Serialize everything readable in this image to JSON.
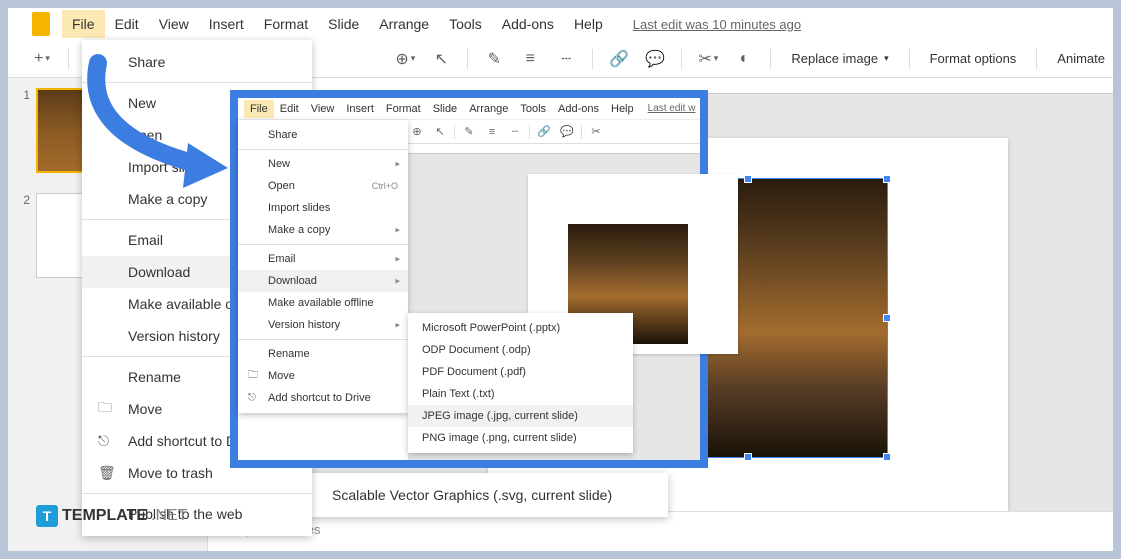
{
  "bg": {
    "menubar": {
      "items": [
        "File",
        "Edit",
        "View",
        "Insert",
        "Format",
        "Slide",
        "Arrange",
        "Tools",
        "Add-ons",
        "Help"
      ],
      "last_edit": "Last edit was 10 minutes ago"
    },
    "toolbar": {
      "replace_image": "Replace image",
      "format_options": "Format options",
      "animate": "Animate"
    },
    "file_menu": {
      "share": "Share",
      "new": "New",
      "open": "Open",
      "import_slides": "Import slides",
      "make_copy": "Make a copy",
      "email": "Email",
      "download": "Download",
      "make_offline": "Make available offline",
      "version_history": "Version history",
      "rename": "Rename",
      "move": "Move",
      "add_shortcut": "Add shortcut to Drive",
      "move_trash": "Move to trash",
      "publish_web": "Publish to the web"
    },
    "download_menu": {
      "svg": "Scalable Vector Graphics (.svg, current slide)"
    },
    "thumbs": {
      "n1": "1",
      "n2": "2"
    },
    "speaker_notes": "d speaker notes"
  },
  "inset": {
    "menubar": {
      "items": [
        "File",
        "Edit",
        "View",
        "Insert",
        "Format",
        "Slide",
        "Arrange",
        "Tools",
        "Add-ons",
        "Help"
      ],
      "last_edit": "Last edit w"
    },
    "file_menu": {
      "share": "Share",
      "new": "New",
      "open": "Open",
      "open_sc": "Ctrl+O",
      "import_slides": "Import slides",
      "make_copy": "Make a copy",
      "email": "Email",
      "download": "Download",
      "make_offline": "Make available offline",
      "version_history": "Version history",
      "rename": "Rename",
      "move": "Move",
      "add_shortcut": "Add shortcut to Drive"
    },
    "download_menu": {
      "pptx": "Microsoft PowerPoint (.pptx)",
      "odp": "ODP Document (.odp)",
      "pdf": "PDF Document (.pdf)",
      "txt": "Plain Text (.txt)",
      "jpg": "JPEG image (.jpg, current slide)",
      "png": "PNG image (.png, current slide)"
    }
  },
  "watermark": {
    "brand": "TEMPLATE",
    "suffix": ".NET"
  }
}
